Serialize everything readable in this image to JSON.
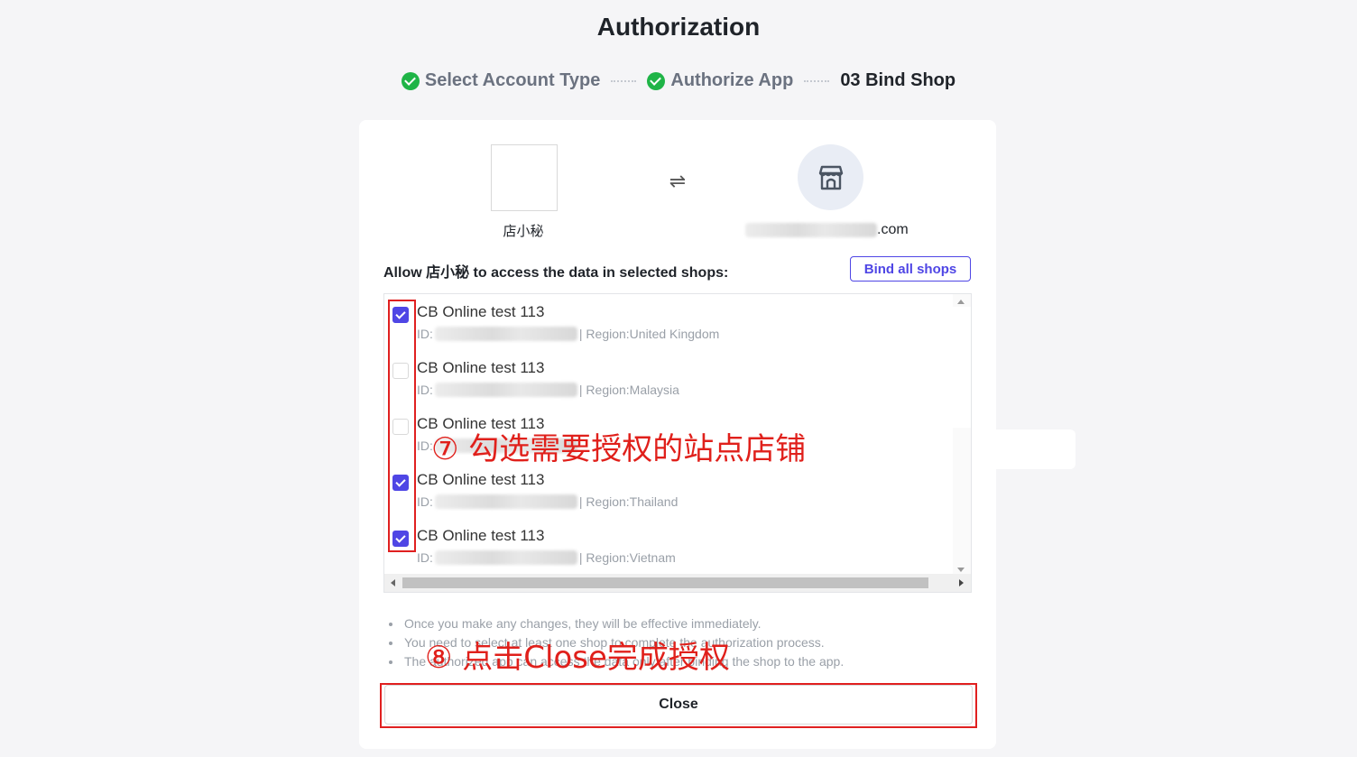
{
  "title": "Authorization",
  "steps": [
    {
      "label": "Select Account Type",
      "state": "done"
    },
    {
      "label": "Authorize App",
      "state": "done"
    },
    {
      "label": "03 Bind Shop",
      "state": "current"
    }
  ],
  "app": {
    "name": "店小秘"
  },
  "platform": {
    "domain_suffix": ".com",
    "icon": "store-icon"
  },
  "swap_icon": "⇌",
  "allow_text": "Allow 店小秘 to access the data in selected shops:",
  "bind_all_label": "Bind all shops",
  "id_label": "ID:",
  "region_prefix": "| Region: ",
  "shops": [
    {
      "name": "CB Online test 113",
      "region": "United Kingdom",
      "checked": true
    },
    {
      "name": "CB Online test 113",
      "region": "Malaysia",
      "checked": false
    },
    {
      "name": "CB Online test 113",
      "region": "",
      "checked": false
    },
    {
      "name": "CB Online test 113",
      "region": "Thailand",
      "checked": true
    },
    {
      "name": "CB Online test 113",
      "region": "Vietnam",
      "checked": true
    }
  ],
  "notes": [
    "Once you make any changes, they will be effective immediately.",
    "You need to select at least one shop to complete the authorization process.",
    "The authorized app can access the data only after binding the shop to the app."
  ],
  "close_label": "Close",
  "annotations": {
    "step7": "⑦ 勾选需要授权的站点店铺",
    "step8": "⑧ 点击Close完成授权"
  },
  "colors": {
    "accent": "#4f46e5",
    "success": "#1fb447",
    "annotation": "#e0201b"
  }
}
